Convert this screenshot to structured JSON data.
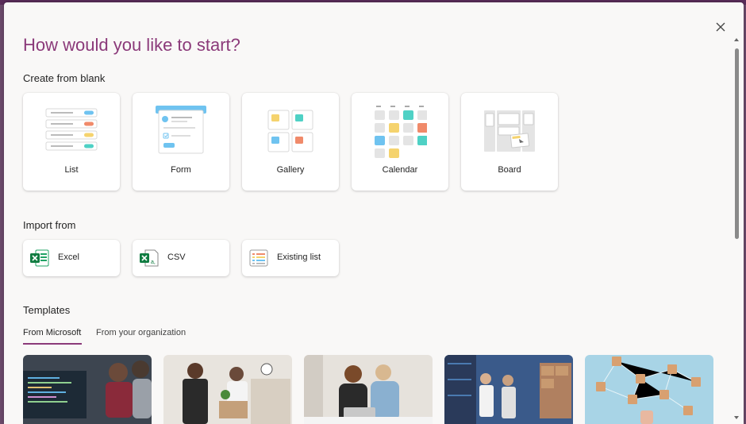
{
  "dialog": {
    "title": "How would you like to start?",
    "close_icon": "close-icon"
  },
  "create_blank": {
    "heading": "Create from blank",
    "items": [
      {
        "label": "List",
        "icon": "list-illustration-icon"
      },
      {
        "label": "Form",
        "icon": "form-illustration-icon"
      },
      {
        "label": "Gallery",
        "icon": "gallery-illustration-icon"
      },
      {
        "label": "Calendar",
        "icon": "calendar-illustration-icon"
      },
      {
        "label": "Board",
        "icon": "board-illustration-icon"
      }
    ]
  },
  "import_from": {
    "heading": "Import from",
    "items": [
      {
        "label": "Excel",
        "icon": "excel-icon"
      },
      {
        "label": "CSV",
        "icon": "csv-icon"
      },
      {
        "label": "Existing list",
        "icon": "existing-list-icon"
      }
    ]
  },
  "templates": {
    "heading": "Templates",
    "tabs": [
      {
        "label": "From Microsoft",
        "active": true
      },
      {
        "label": "From your organization",
        "active": false
      }
    ],
    "thumbnails": [
      {
        "name": "template-thumbnail-coding"
      },
      {
        "name": "template-thumbnail-onboarding"
      },
      {
        "name": "template-thumbnail-meeting"
      },
      {
        "name": "template-thumbnail-warehouse"
      },
      {
        "name": "template-thumbnail-network"
      }
    ]
  },
  "colors": {
    "accent": "#8b3a7a",
    "blue": "#6fc3f0",
    "teal": "#4fd1c5",
    "orange": "#f08a6a",
    "yellow": "#f5d36e"
  }
}
